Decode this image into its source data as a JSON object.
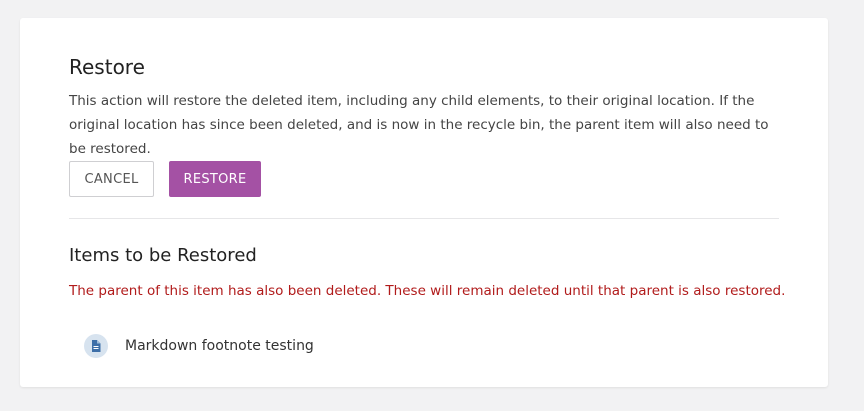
{
  "restore": {
    "title": "Restore",
    "description": "This action will restore the deleted item, including any child elements, to their original location. If the original location has since been deleted, and is now in the recycle bin, the parent item will also need to be restored.",
    "cancel_label": "CANCEL",
    "restore_label": "RESTORE"
  },
  "items_section": {
    "title": "Items to be Restored",
    "warning": "The parent of this item has also been deleted. These will remain deleted until that parent is also restored.",
    "items": [
      {
        "label": "Markdown footnote testing",
        "icon": "document-icon"
      }
    ]
  },
  "colors": {
    "accent": "#a451a4",
    "warning": "#b11b1b",
    "icon_badge": "#d7e3ef",
    "icon": "#3d6fa8"
  }
}
